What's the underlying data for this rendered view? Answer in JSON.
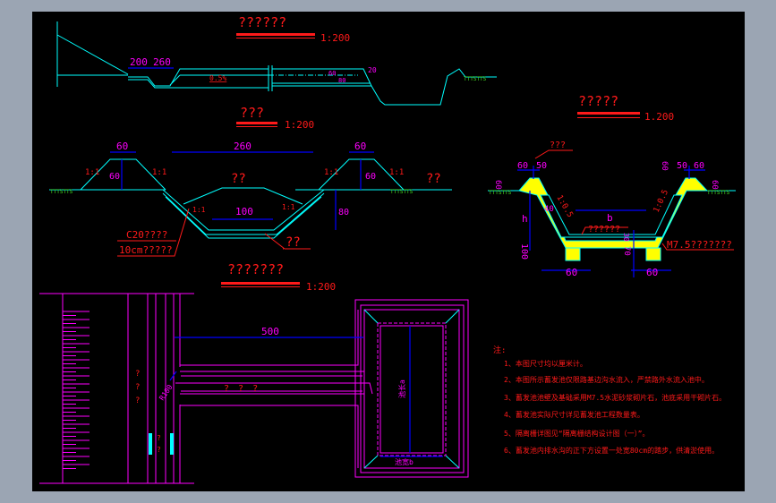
{
  "colors": {
    "background": "#000000",
    "frame": "#9ba5b3",
    "title": "#ff1a1a",
    "dimension": "#ff00ff",
    "outline": "#00ffff",
    "dim_line": "#0000ff",
    "fill": "#ffff00",
    "ground": "#44dd22"
  },
  "profile": {
    "title": "??????",
    "scale": "1:200",
    "dims": [
      "200",
      "260"
    ],
    "slope": "0.5%",
    "d1": "60",
    "d2": "80",
    "d3": "20",
    "ground": "TTTSTTS"
  },
  "section": {
    "title": "???",
    "scale": "1:200",
    "top_width_left": "60",
    "height_left": "60",
    "slope_l1": "1:1",
    "slope_l2": "1:1",
    "width_260": "260",
    "top_width_right": "60",
    "height_right": "60",
    "slope_r1": "1:1",
    "slope_r2": "1:1",
    "center_label": "??",
    "right_label": "??",
    "bottom_width": "100",
    "depth": "80",
    "slope_in_l": "1:1",
    "slope_in_r": "1:1",
    "lining1": "C20????",
    "lining2": "10cm?????",
    "bottom_label": "??",
    "ground": "TTTSTTS"
  },
  "plan": {
    "title": "???????",
    "scale": "1:200",
    "length": "500",
    "radius": "R100",
    "channel_label": "? ? ?",
    "road_label": [
      "?",
      "?",
      "?"
    ],
    "small_label": [
      "?",
      "?"
    ],
    "pool_length": "池长a",
    "pool_width": "池宽b"
  },
  "pool_section": {
    "title": "?????",
    "scale": "1.200",
    "top_l": "60",
    "top_l2": "50",
    "h_l": "60",
    "h_r": "60",
    "top_r2": "50",
    "top_r": "60",
    "h_r2": "60",
    "leader_top": "???",
    "slope_l": "1:0.5",
    "slope_r": "1:0.5",
    "thick": "40",
    "depth": "h",
    "width": "b",
    "bottom_label": "??????",
    "base_h": "100",
    "base_h2": "70",
    "base_h3": "30",
    "foot_l": "60",
    "foot_r": "60",
    "material": "M7.5???????"
  },
  "notes": {
    "heading": "注:",
    "items": [
      "1、本图尺寸均以厘米计。",
      "2、本图所示蓄发池仅限路基边沟水流入，严禁路外水流入池中。",
      "3、蓄发池池壁及基础采用M7.5水泥砂浆砌片石，池底采用干砌片石。",
      "4、蓄发池实际尺寸详见蓄发池工程数量表。",
      "5、隔离栅详图见“隔离栅结构设计图（一）”。",
      "6、蓄发池内排水沟的正下方设置一处宽80cm的踏步，供清淤使用。"
    ]
  }
}
